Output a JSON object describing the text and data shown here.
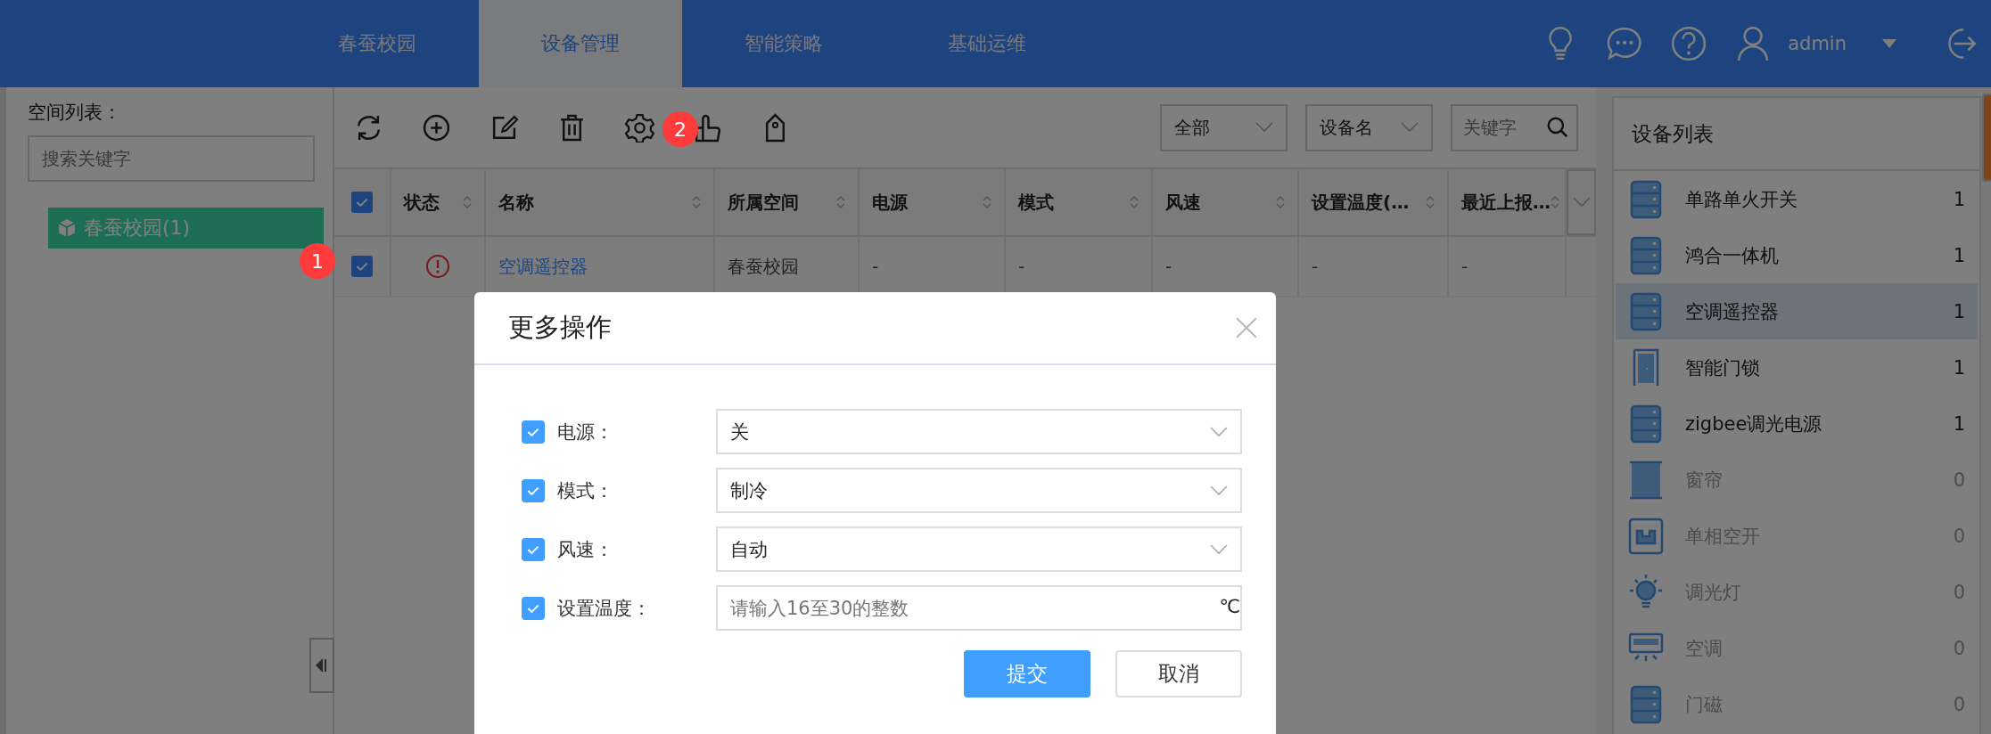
{
  "nav": {
    "tabs": [
      {
        "label": "春蚕校园",
        "selected": false
      },
      {
        "label": "设备管理",
        "selected": true
      },
      {
        "label": "智能策略",
        "selected": false
      },
      {
        "label": "基础运维",
        "selected": false
      }
    ],
    "username": "admin"
  },
  "space_panel": {
    "title": "空间列表：",
    "search": {
      "placeholder": "搜索关键字"
    },
    "tree": [
      {
        "label": "春蚕校园(1)",
        "selected": true
      }
    ]
  },
  "filters": {
    "type_select": "全部",
    "field_select": "设备名",
    "keyword": {
      "placeholder": "关键字"
    }
  },
  "table": {
    "all_checked": true,
    "columns": [
      "状态",
      "名称",
      "所属空间",
      "电源",
      "模式",
      "风速",
      "设置温度(…",
      "最近上报…"
    ],
    "rows": [
      {
        "checked": true,
        "alert": true,
        "name": "空调遥控器",
        "space": "春蚕校园",
        "values": [
          "-",
          "-",
          "-",
          "-",
          "-"
        ]
      }
    ]
  },
  "device_panel": {
    "title": "设备列表",
    "items": [
      {
        "name": "单路单火开关",
        "count": "1",
        "kind": "server",
        "selected": false,
        "disabled": false
      },
      {
        "name": "鸿合一体机",
        "count": "1",
        "kind": "server",
        "selected": false,
        "disabled": false
      },
      {
        "name": "空调遥控器",
        "count": "1",
        "kind": "server",
        "selected": true,
        "disabled": false
      },
      {
        "name": "智能门锁",
        "count": "1",
        "kind": "door",
        "selected": false,
        "disabled": false
      },
      {
        "name": "zigbee调光电源",
        "count": "1",
        "kind": "server",
        "selected": false,
        "disabled": false
      },
      {
        "name": "窗帘",
        "count": "0",
        "kind": "curtain",
        "selected": false,
        "disabled": true
      },
      {
        "name": "单相空开",
        "count": "0",
        "kind": "breaker",
        "selected": false,
        "disabled": true
      },
      {
        "name": "调光灯",
        "count": "0",
        "kind": "bulb",
        "selected": false,
        "disabled": true
      },
      {
        "name": "空调",
        "count": "0",
        "kind": "aircon",
        "selected": false,
        "disabled": true
      },
      {
        "name": "门磁",
        "count": "0",
        "kind": "server",
        "selected": false,
        "disabled": true
      }
    ]
  },
  "dialog": {
    "title": "更多操作",
    "fields": [
      {
        "label": "电源：",
        "checked": true,
        "kind": "select",
        "value": "关"
      },
      {
        "label": "模式：",
        "checked": true,
        "kind": "select",
        "value": "制冷"
      },
      {
        "label": "风速：",
        "checked": true,
        "kind": "select",
        "value": "自动"
      },
      {
        "label": "设置温度：",
        "checked": true,
        "kind": "input",
        "placeholder": "请输入16至30的整数",
        "unit": "℃"
      }
    ],
    "buttons": [
      {
        "label": "提交",
        "primary": true
      },
      {
        "label": "取消",
        "primary": false
      }
    ]
  },
  "markers": [
    "1",
    "2"
  ]
}
